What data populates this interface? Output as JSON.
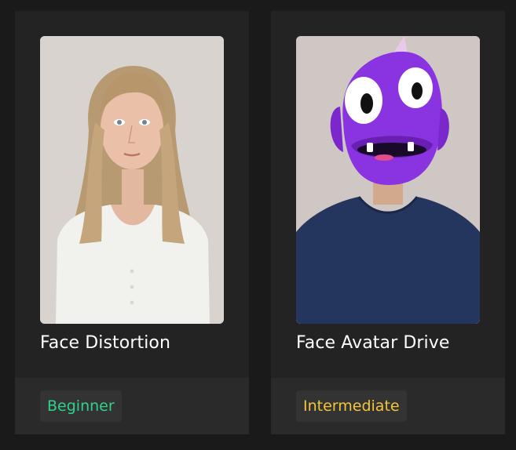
{
  "cards": [
    {
      "title": "Face Distortion",
      "level": "Beginner",
      "level_color": "#2fd28c",
      "thumbnail_icon": "woman-portrait-thumbnail"
    },
    {
      "title": "Face Avatar Drive",
      "level": "Intermediate",
      "level_color": "#f3c53a",
      "thumbnail_icon": "purple-monster-avatar-thumbnail"
    }
  ]
}
